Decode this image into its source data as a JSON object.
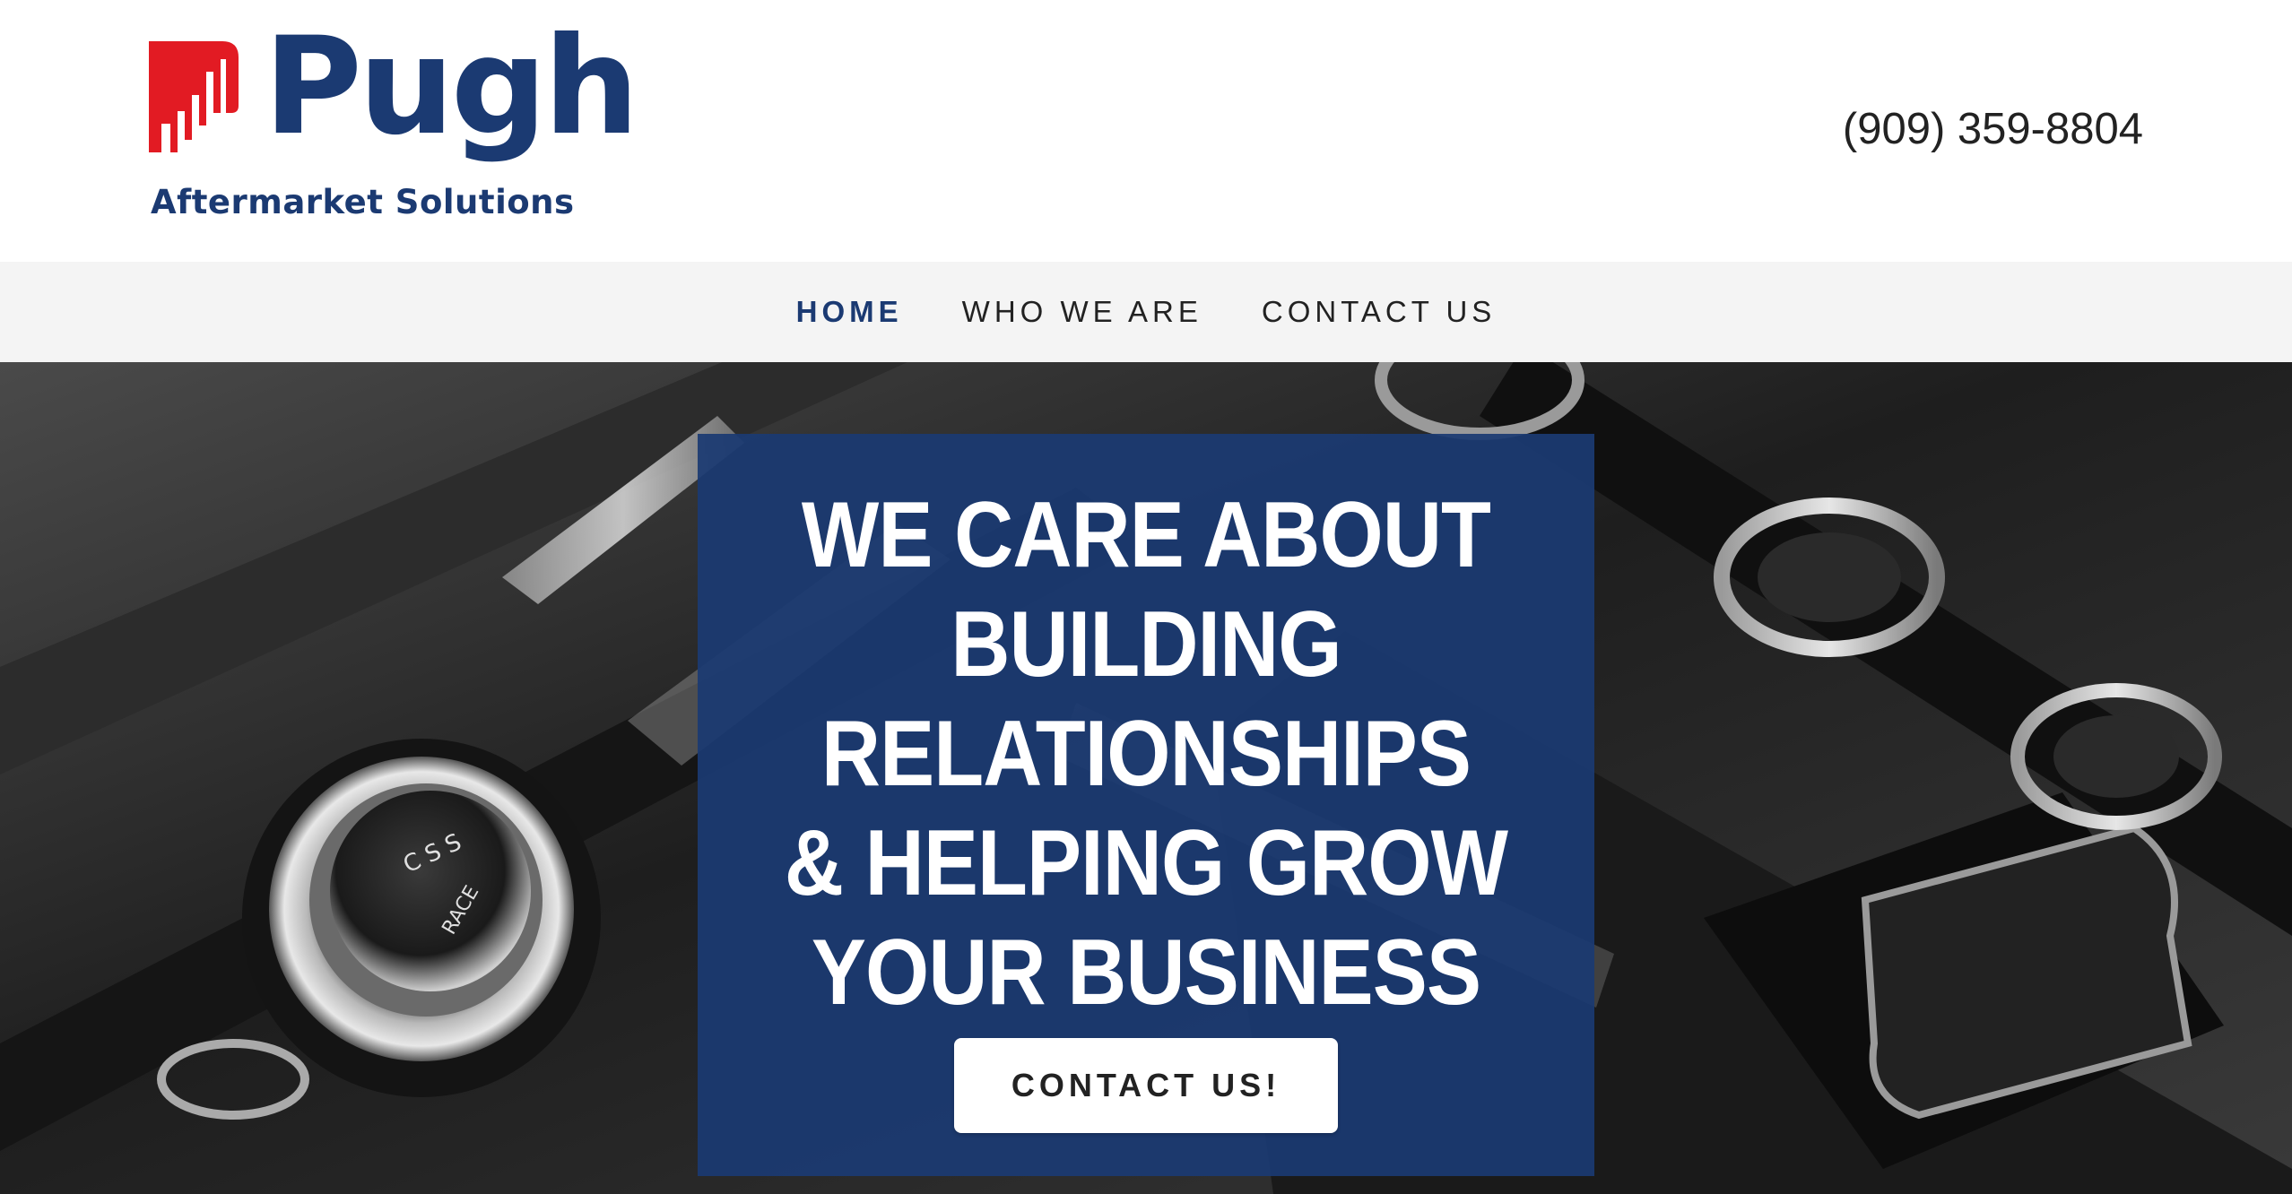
{
  "brand": {
    "name": "Pugh",
    "tagline": "Aftermarket Solutions",
    "logo_icon": "bar-chart-logo-mark",
    "primary_color": "#1b3a72",
    "accent_color": "#e21b23"
  },
  "header": {
    "phone": "(909) 359-8804"
  },
  "nav": {
    "items": [
      {
        "label": "HOME",
        "active": true
      },
      {
        "label": "WHO WE ARE",
        "active": false
      },
      {
        "label": "CONTACT US",
        "active": false
      }
    ]
  },
  "hero": {
    "headline": "WE CARE ABOUT BUILDING RELATIONSHIPS & HELPING GROW YOUR BUSINESS",
    "cta_label": "CONTACT US!",
    "card_color": "#1b3a72",
    "background_image": "car-interior-controls-photo"
  }
}
